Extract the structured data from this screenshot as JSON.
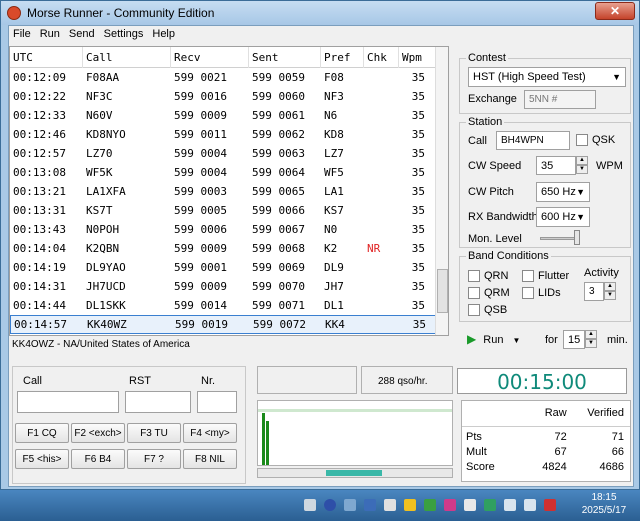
{
  "window": {
    "title": "Morse Runner - Community Edition",
    "close": "✕"
  },
  "menu": [
    "File",
    "Run",
    "Send",
    "Settings",
    "Help"
  ],
  "log": {
    "headers": [
      "UTC",
      "Call",
      "Recv",
      "Sent",
      "Pref",
      "Chk",
      "Wpm"
    ],
    "rows": [
      [
        "00:12:09",
        "F08AA",
        "599 0021",
        "599 0059",
        "F08",
        "",
        "35"
      ],
      [
        "00:12:22",
        "NF3C",
        "599 0016",
        "599 0060",
        "NF3",
        "",
        "35"
      ],
      [
        "00:12:33",
        "N60V",
        "599 0009",
        "599 0061",
        "N6",
        "",
        "35"
      ],
      [
        "00:12:46",
        "KD8NYO",
        "599 0011",
        "599 0062",
        "KD8",
        "",
        "35"
      ],
      [
        "00:12:57",
        "LZ70",
        "599 0004",
        "599 0063",
        "LZ7",
        "",
        "35"
      ],
      [
        "00:13:08",
        "WF5K",
        "599 0004",
        "599 0064",
        "WF5",
        "",
        "35"
      ],
      [
        "00:13:21",
        "LA1XFA",
        "599 0003",
        "599 0065",
        "LA1",
        "",
        "35"
      ],
      [
        "00:13:31",
        "KS7T",
        "599 0005",
        "599 0066",
        "KS7",
        "",
        "35"
      ],
      [
        "00:13:43",
        "N0POH",
        "599 0006",
        "599 0067",
        "N0",
        "",
        "35"
      ],
      [
        "00:14:04",
        "K2QBN",
        "599 0009",
        "599 0068",
        "K2",
        "NR",
        "35"
      ],
      [
        "00:14:19",
        "DL9YAO",
        "599 0001",
        "599 0069",
        "DL9",
        "",
        "35"
      ],
      [
        "00:14:31",
        "JH7UCD",
        "599 0009",
        "599 0070",
        "JH7",
        "",
        "35"
      ],
      [
        "00:14:44",
        "DL1SKK",
        "599 0014",
        "599 0071",
        "DL1",
        "",
        "35"
      ],
      [
        "00:14:57",
        "KK40WZ",
        "599 0019",
        "599 0072",
        "KK4",
        "",
        "35"
      ]
    ],
    "status": "KK4OWZ - NA/United States of America"
  },
  "contest": {
    "group": "Contest",
    "selected": "HST (High Speed Test)",
    "exchange_label": "Exchange",
    "exchange_value": "5NN #"
  },
  "station": {
    "group": "Station",
    "call_label": "Call",
    "call_value": "BH4WPN",
    "qsk_label": "QSK",
    "cw_speed_label": "CW Speed",
    "cw_speed_value": "35",
    "wpm_label": "WPM",
    "cw_pitch_label": "CW Pitch",
    "cw_pitch_value": "650 Hz",
    "rx_bw_label": "RX Bandwidth",
    "rx_bw_value": "600 Hz",
    "mon_level_label": "Mon. Level"
  },
  "band": {
    "group": "Band Conditions",
    "qrn": "QRN",
    "qrm": "QRM",
    "qsb": "QSB",
    "flutter": "Flutter",
    "lids": "LIDs",
    "activity_label": "Activity",
    "activity_value": "3"
  },
  "run": {
    "run_label": "Run",
    "for_label": "for",
    "minutes_value": "15",
    "min_label": "min."
  },
  "entry": {
    "call_label": "Call",
    "rst_label": "RST",
    "nr_label": "Nr."
  },
  "fkeys": [
    "F1  CQ",
    "F2 <exch>",
    "F3  TU",
    "F4 <my>",
    "F5 <his>",
    "F6  B4",
    "F7  ?",
    "F8  NIL"
  ],
  "rate": "288  qso/hr.",
  "clock": "00:15:00",
  "score": {
    "headers": [
      "",
      "Raw",
      "Verified"
    ],
    "rows": [
      [
        "Pts",
        "72",
        "71"
      ],
      [
        "Mult",
        "67",
        "66"
      ],
      [
        "Score",
        "4824",
        "4686"
      ]
    ]
  },
  "taskbar": {
    "time": "18:15",
    "date": "2025/5/17"
  }
}
